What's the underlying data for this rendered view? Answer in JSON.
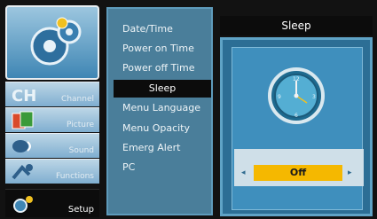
{
  "nav": {
    "items": [
      {
        "label": "Channel",
        "icon": "channel-icon"
      },
      {
        "label": "Picture",
        "icon": "picture-icon"
      },
      {
        "label": "Sound",
        "icon": "sound-icon"
      },
      {
        "label": "Functions",
        "icon": "functions-icon"
      },
      {
        "label": "Setup",
        "icon": "setup-icon"
      }
    ],
    "hero_icon": "gears-icon",
    "active": "Setup"
  },
  "menu": {
    "items": [
      "Date/Time",
      "Power on Time",
      "Power off Time",
      "Sleep",
      "Menu Language",
      "Menu Opacity",
      "Emerg Alert",
      "PC"
    ],
    "selected": "Sleep"
  },
  "panel": {
    "title": "Sleep",
    "icon": "clock-icon",
    "value": "Off",
    "left_arrow": "◂",
    "right_arrow": "▸"
  },
  "colors": {
    "highlight": "#f5b800",
    "panel_blue": "#2c6e95",
    "menu_blue": "#4a7e9a"
  }
}
